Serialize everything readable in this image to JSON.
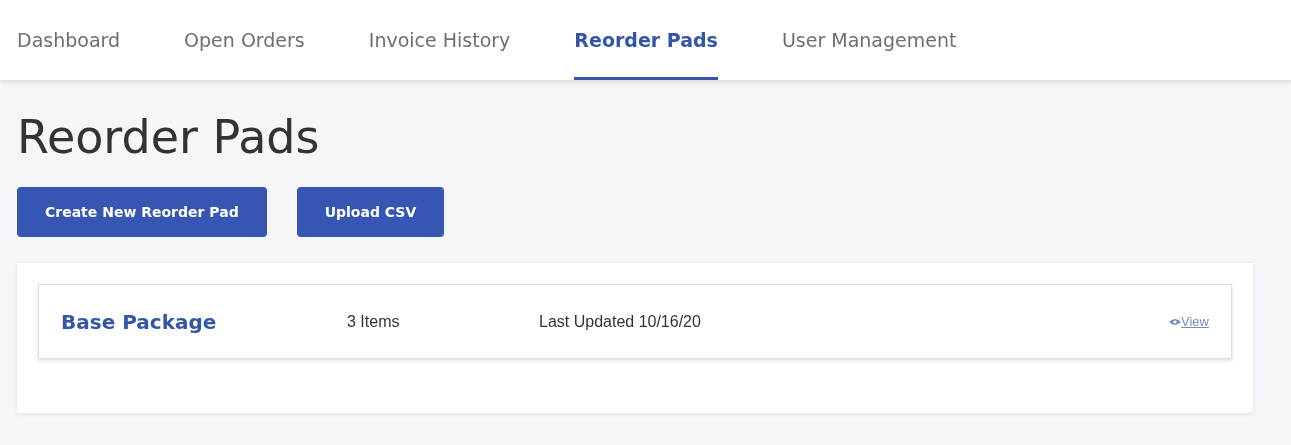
{
  "tabs": [
    {
      "label": "Dashboard",
      "selected": false
    },
    {
      "label": "Open Orders",
      "selected": false
    },
    {
      "label": "Invoice History",
      "selected": false
    },
    {
      "label": "Reorder Pads",
      "selected": true
    },
    {
      "label": "User Management",
      "selected": false
    }
  ],
  "page_title": "Reorder Pads",
  "buttons": [
    "Create New Reorder Pad",
    "Upload CSV"
  ],
  "pads": [
    {
      "name": "Base Package",
      "items": "3 Items",
      "updated": "Last Updated 10/16/20",
      "action": "View"
    }
  ]
}
